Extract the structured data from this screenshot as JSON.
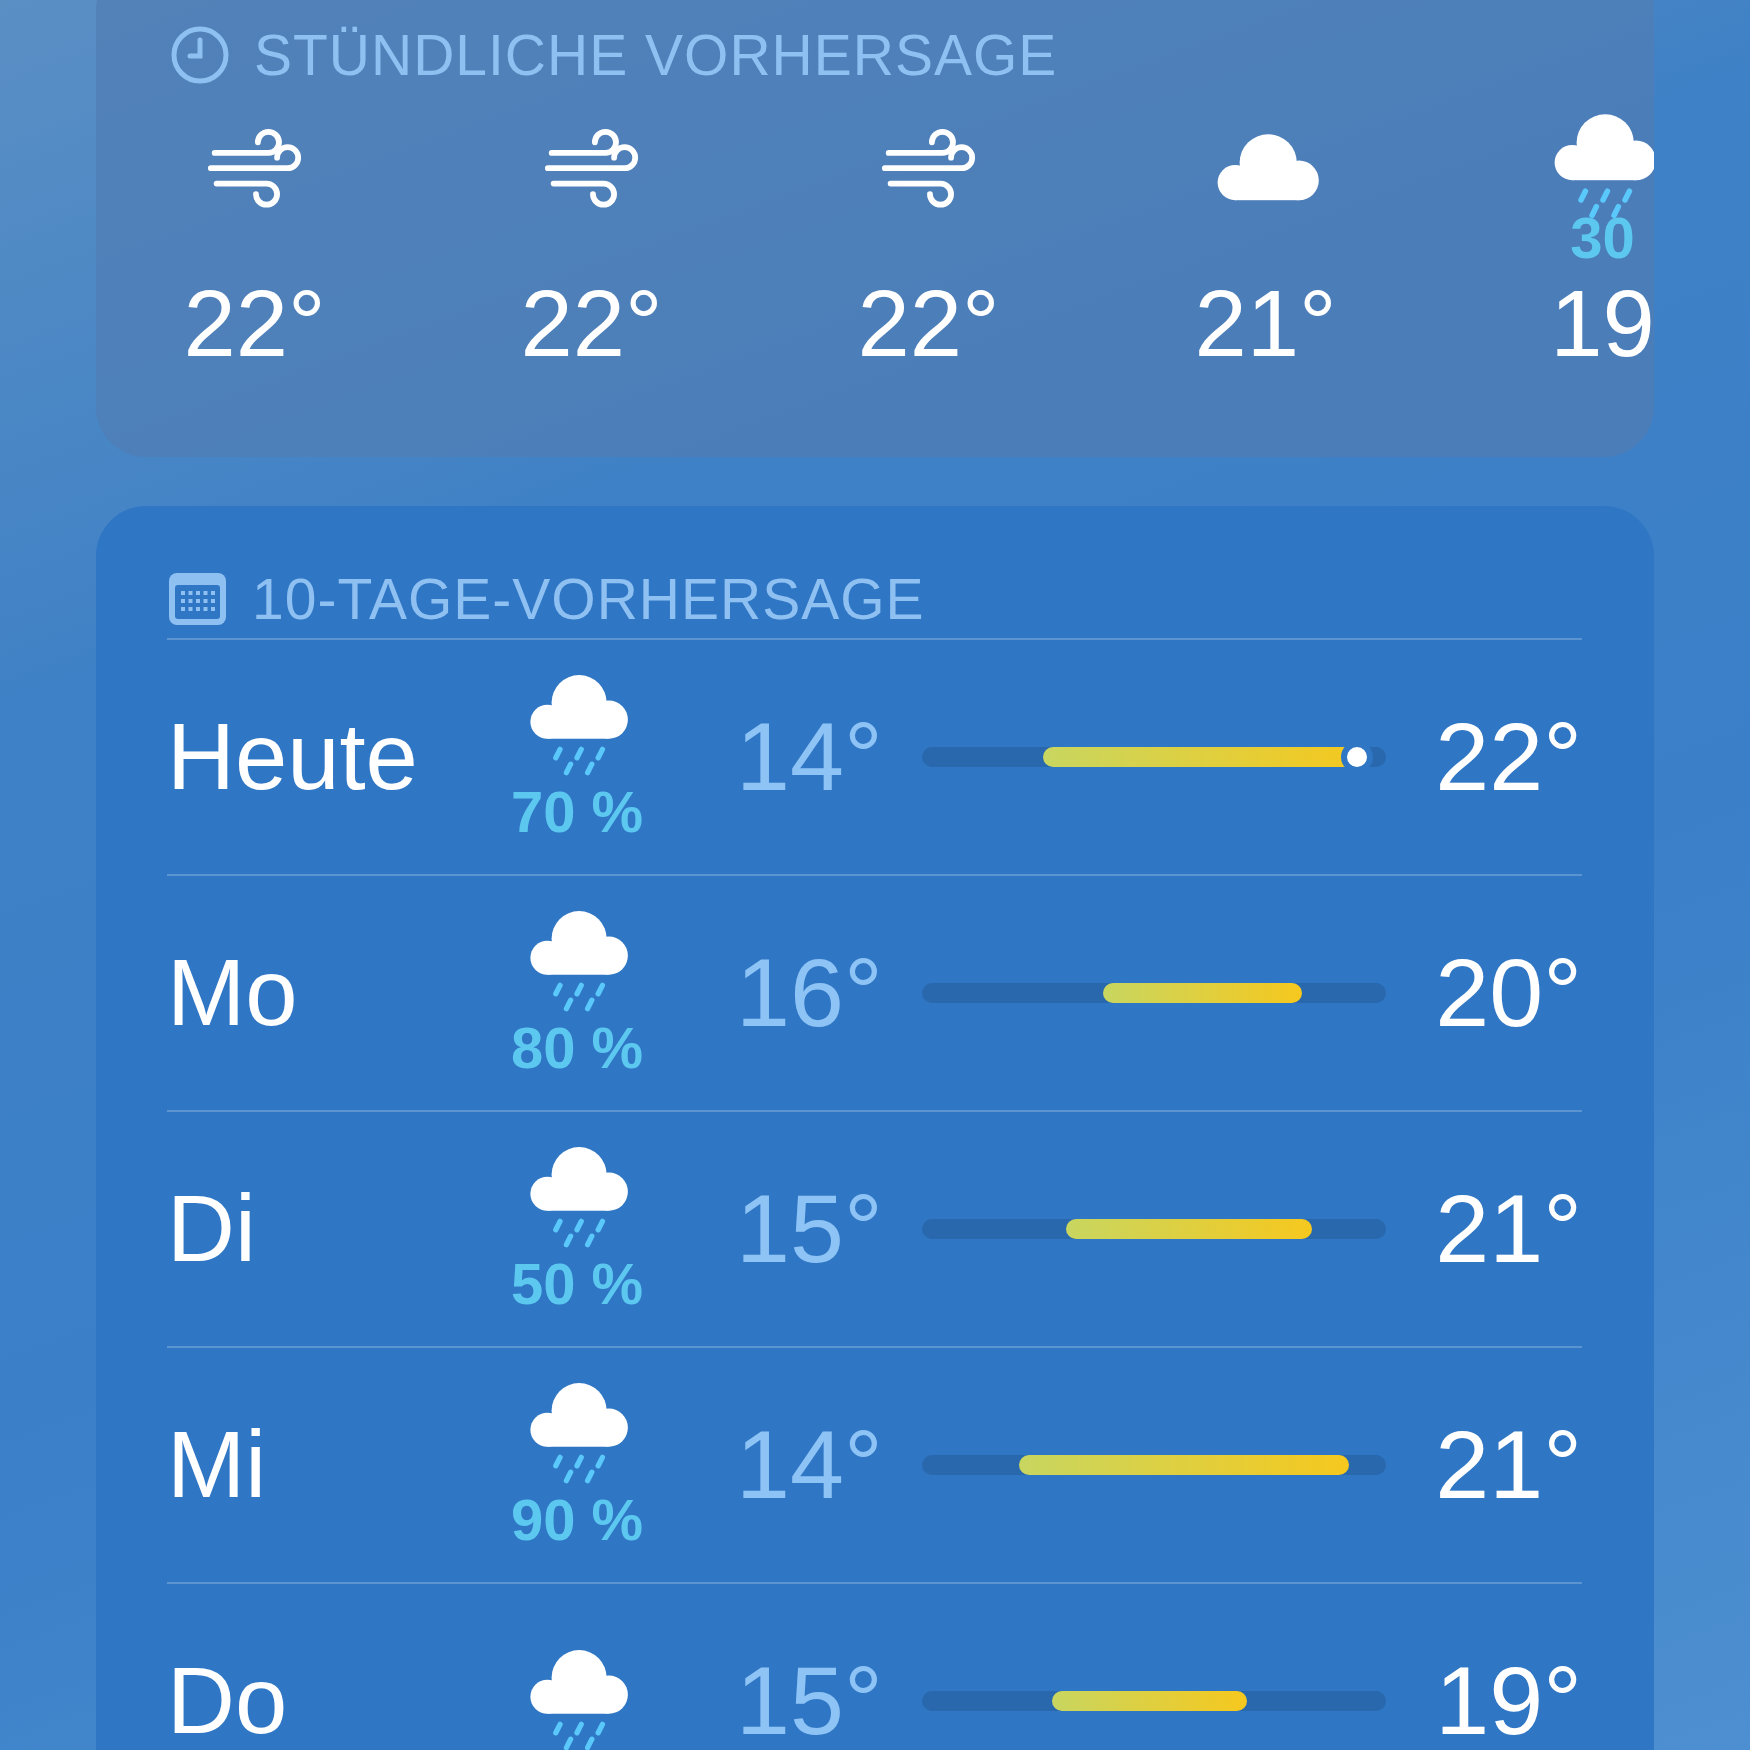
{
  "hourly": {
    "title": "STÜNDLICHE VORHERSAGE",
    "hours": [
      {
        "kind": "wind",
        "temp": "22°"
      },
      {
        "kind": "wind",
        "temp": "22°"
      },
      {
        "kind": "wind",
        "temp": "22°"
      },
      {
        "kind": "cloud",
        "temp": "21°"
      },
      {
        "kind": "rain",
        "precip": "30",
        "temp": "19"
      }
    ]
  },
  "daily": {
    "title": "10-TAGE-VORHERSAGE",
    "days": [
      {
        "day": "Heute",
        "kind": "rain",
        "precip": "70 %",
        "low": "14°",
        "high": "22°",
        "current": true
      },
      {
        "day": "Mo",
        "kind": "rain",
        "precip": "80 %",
        "low": "16°",
        "high": "20°",
        "current": false
      },
      {
        "day": "Di",
        "kind": "rain",
        "precip": "50 %",
        "low": "15°",
        "high": "21°",
        "current": false
      },
      {
        "day": "Mi",
        "kind": "rain",
        "precip": "90 %",
        "low": "14°",
        "high": "21°",
        "current": false
      },
      {
        "day": "Do",
        "kind": "rain",
        "low": "15°",
        "high": "19°",
        "current": false
      }
    ]
  }
}
